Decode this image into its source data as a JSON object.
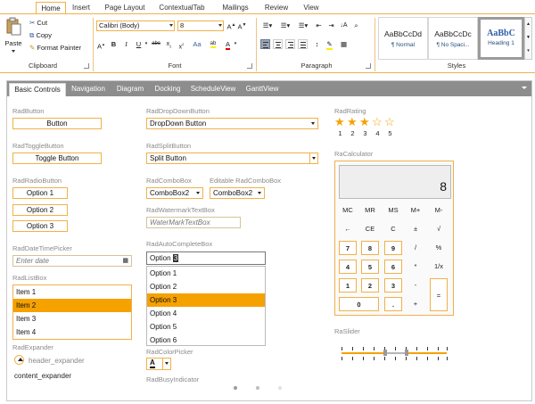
{
  "ribbon": {
    "tabs": [
      "Home",
      "Insert",
      "Page Layout",
      "ContextualTab",
      "Mailings",
      "Review",
      "View"
    ],
    "active_tab": "Home",
    "clipboard": {
      "label": "Clipboard",
      "paste": "Paste",
      "cut": "Cut",
      "copy": "Copy",
      "format_painter": "Format Painter"
    },
    "font": {
      "label": "Font",
      "family": "Calibri (Body)",
      "size": "8"
    },
    "paragraph": {
      "label": "Paragraph"
    },
    "styles": {
      "label": "Styles",
      "items": [
        {
          "sample": "AaBbCcDd",
          "name": "¶ Normal"
        },
        {
          "sample": "AaBbCcDc",
          "name": "¶ No Spaci..."
        },
        {
          "sample": "AaBbC",
          "name": "Heading 1"
        }
      ]
    }
  },
  "demo_tabs": [
    "Basic Controls",
    "Navigation",
    "Diagram",
    "Docking",
    "ScheduleView",
    "GanttView"
  ],
  "controls": {
    "button": {
      "label": "RadButton",
      "text": "Button"
    },
    "toggle": {
      "label": "RadToggleButton",
      "text": "Toggle Button"
    },
    "radio": {
      "label": "RadRadioButton",
      "options": [
        "Option 1",
        "Option 2",
        "Option 3"
      ]
    },
    "datetime": {
      "label": "RadDateTimePicker",
      "placeholder": "Enter date"
    },
    "listbox": {
      "label": "RadListBox",
      "items": [
        "Item 1",
        "Item 2",
        "Item 3",
        "Item 4"
      ],
      "selected": "Item 2"
    },
    "expander": {
      "label": "RadExpander",
      "header": "header_expander",
      "content": "content_expander"
    },
    "dropdown": {
      "label": "RadDropDownButton",
      "text": "DropDown Button"
    },
    "split": {
      "label": "RadSplitButton",
      "text": "Split Button"
    },
    "combo": {
      "label": "RadComboBox",
      "value": "ComboBox2"
    },
    "editable_combo": {
      "label": "Editable RadComboBox",
      "value": "ComboBox2"
    },
    "watermark": {
      "label": "RadWatermarkTextBox",
      "placeholder": "WaterMarkTextBox"
    },
    "autocomplete": {
      "label": "RadAutoCompleteBox",
      "typed": "Option",
      "typed_highlight": "3",
      "options": [
        "Option 1",
        "Option 2",
        "Option 3",
        "Option 4",
        "Option 5",
        "Option 6"
      ],
      "selected": "Option 3"
    },
    "colorpicker": {
      "label": "RadColorPicker",
      "glyph": "A"
    },
    "busy": {
      "label": "RadBusyIndicator"
    },
    "rating": {
      "label": "RadRating",
      "value": 3,
      "max": 5,
      "numbers": [
        "1",
        "2",
        "3",
        "4",
        "5"
      ]
    },
    "calculator": {
      "label": "RaCalculator",
      "display": "8",
      "keys": [
        [
          "MC",
          "MR",
          "MS",
          "M+",
          "M-"
        ],
        [
          "←",
          "CE",
          "C",
          "±",
          "√"
        ],
        [
          "7",
          "8",
          "9",
          "/",
          "%"
        ],
        [
          "4",
          "5",
          "6",
          "*",
          "1/x"
        ],
        [
          "1",
          "2",
          "3",
          "-",
          "="
        ],
        [
          "0",
          ".",
          "+"
        ]
      ]
    },
    "slider": {
      "label": "RaSlider"
    }
  },
  "colors": {
    "accent": "#f5a100",
    "border_accent": "#f0b14a",
    "tab_strip": "#8d8d8d"
  }
}
